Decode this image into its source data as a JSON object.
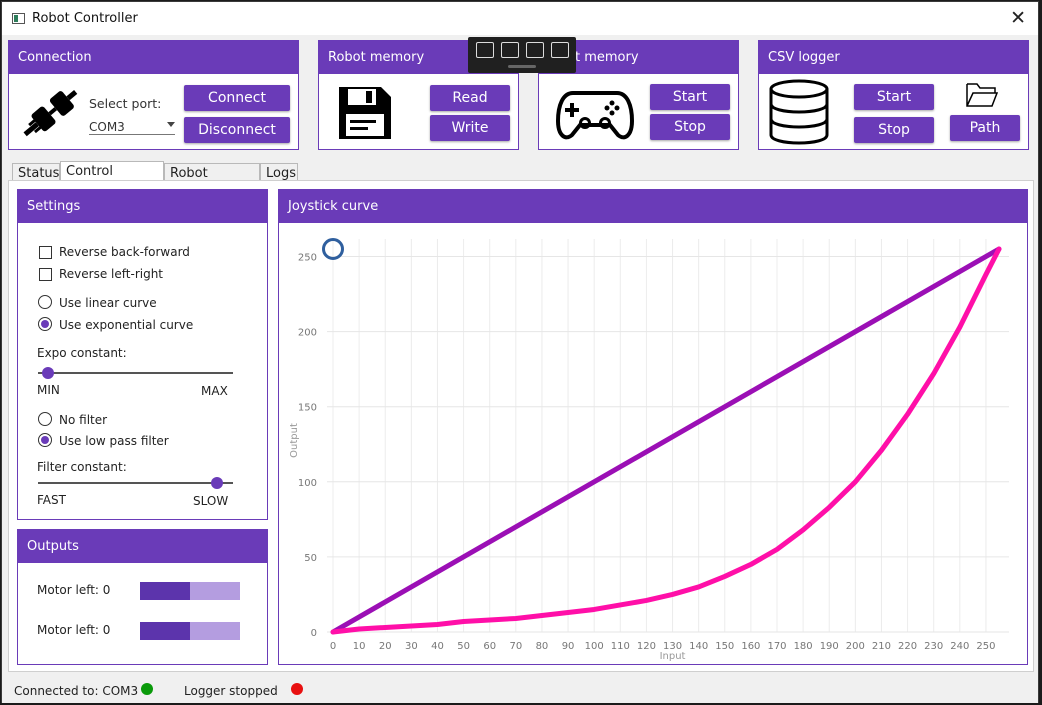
{
  "window": {
    "title": "Robot Controller",
    "close_glyph": "✕"
  },
  "connection": {
    "title": "Connection",
    "select_port_label": "Select port:",
    "port_value": "COM3",
    "connect_label": "Connect",
    "disconnect_label": "Disconnect",
    "icon": "plug-icon"
  },
  "robot_memory": {
    "title": "Robot memory",
    "read_label": "Read",
    "write_label": "Write",
    "icon": "floppy-disk-icon"
  },
  "game_memory": {
    "title": "t memory",
    "start_label": "Start",
    "stop_label": "Stop",
    "icon": "gamepad-icon"
  },
  "csv_logger": {
    "title": "CSV logger",
    "start_label": "Start",
    "stop_label": "Stop",
    "path_label": "Path",
    "icon": "database-icon",
    "folder_icon": "folder-icon"
  },
  "tabs": [
    {
      "label": "Status"
    },
    {
      "label": "Control settings"
    },
    {
      "label": "Robot settings"
    },
    {
      "label": "Logs"
    }
  ],
  "settings": {
    "title": "Settings",
    "reverse_back_forward": "Reverse back-forward",
    "reverse_left_right": "Reverse left-right",
    "use_linear_curve": "Use linear curve",
    "use_exponential_curve": "Use exponential curve",
    "expo_constant_label": "Expo constant:",
    "expo_min": "MIN",
    "expo_max": "MAX",
    "expo_value": 0.05,
    "no_filter": "No filter",
    "use_low_pass_filter": "Use low pass filter",
    "filter_constant_label": "Filter constant:",
    "filter_fast": "FAST",
    "filter_slow": "SLOW",
    "filter_value": 0.92,
    "selected_curve": "exponential",
    "selected_filter": "low-pass"
  },
  "outputs": {
    "title": "Outputs",
    "items": [
      {
        "label": "Motor left: 0",
        "level": 0.5
      },
      {
        "label": "Motor left: 0",
        "level": 0.5
      }
    ]
  },
  "joystick_curve": {
    "title": "Joystick curve"
  },
  "chart_data": {
    "type": "line",
    "title": "",
    "xlabel": "Input",
    "ylabel": "Output",
    "xlim": [
      0,
      255
    ],
    "ylim": [
      0,
      255
    ],
    "x_ticks": [
      0,
      10,
      20,
      30,
      40,
      50,
      60,
      70,
      80,
      90,
      100,
      110,
      120,
      130,
      140,
      150,
      160,
      170,
      180,
      190,
      200,
      210,
      220,
      230,
      240,
      250
    ],
    "y_ticks": [
      0,
      50,
      100,
      150,
      200,
      250
    ],
    "grid": true,
    "series": [
      {
        "color": "#9b0fb5",
        "x": [
          0,
          255
        ],
        "y": [
          0,
          255
        ]
      },
      {
        "color": "#ff0fa8",
        "x": [
          0,
          10,
          20,
          30,
          40,
          50,
          60,
          70,
          80,
          90,
          100,
          110,
          120,
          130,
          140,
          150,
          160,
          170,
          180,
          190,
          200,
          210,
          220,
          230,
          240,
          250,
          255
        ],
        "y": [
          0,
          2,
          3,
          4,
          5,
          7,
          8,
          9,
          11,
          13,
          15,
          18,
          21,
          25,
          30,
          37,
          45,
          55,
          68,
          83,
          100,
          121,
          145,
          172,
          203,
          238,
          255
        ]
      }
    ],
    "marker": {
      "x": 0,
      "y": 255,
      "color": "#2f5f9e"
    }
  },
  "status": {
    "connected_text": "Connected to: COM3",
    "connected_color": "#0a9a0a",
    "logger_text": "Logger stopped",
    "logger_color": "#e81010"
  }
}
